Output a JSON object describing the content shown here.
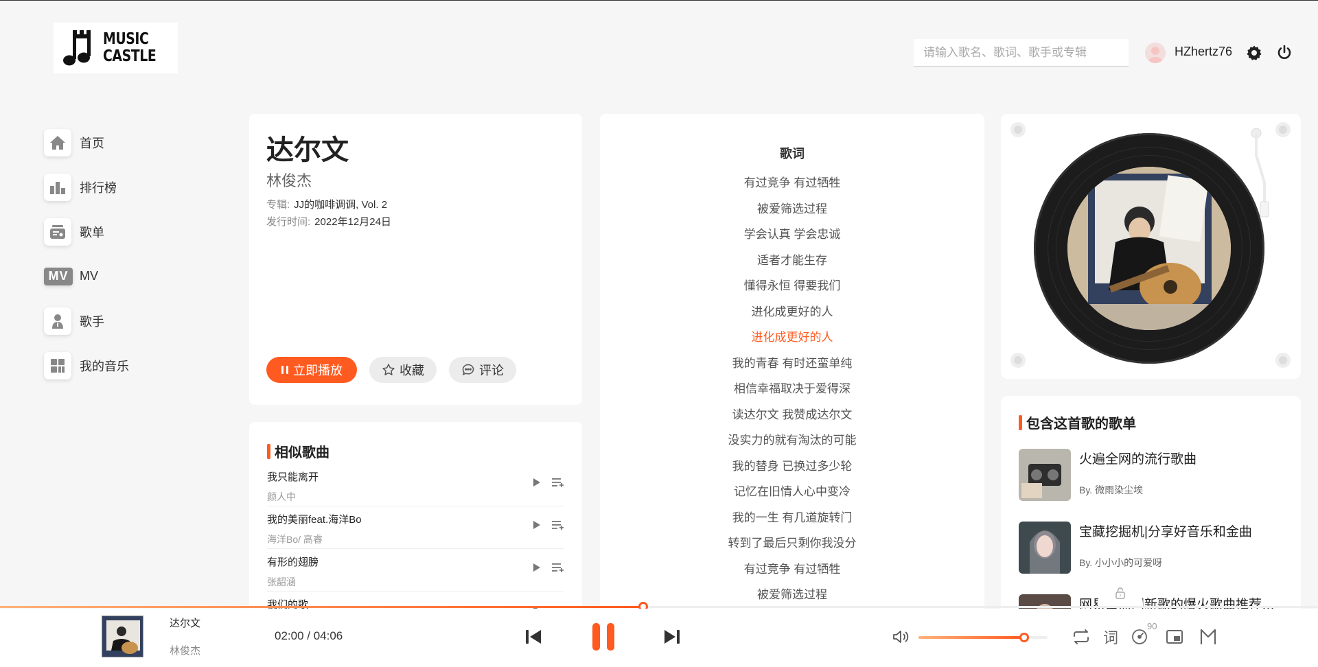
{
  "header": {
    "logo_text_1": "MUSIC",
    "logo_text_2": "CASTLE",
    "search_placeholder": "请输入歌名、歌词、歌手或专辑",
    "username": "HZhertz76"
  },
  "sidebar": {
    "items": [
      {
        "label": "首页",
        "icon": "home-icon"
      },
      {
        "label": "排行榜",
        "icon": "chart-icon"
      },
      {
        "label": "歌单",
        "icon": "playlist-icon"
      },
      {
        "label": "MV",
        "icon": "mv-icon"
      },
      {
        "label": "歌手",
        "icon": "singer-icon"
      },
      {
        "label": "我的音乐",
        "icon": "my-music-icon"
      }
    ],
    "mv_badge": "MV"
  },
  "song": {
    "title": "达尔文",
    "artist": "林俊杰",
    "album_label": "专辑:",
    "album": "JJ的咖啡调调, Vol. 2",
    "release_label": "发行时间:",
    "release": "2022年12月24日",
    "play_label": "立即播放",
    "collect_label": "收藏",
    "comment_label": "评论"
  },
  "similar": {
    "title": "相似歌曲",
    "songs": [
      {
        "name": "我只能离开",
        "artist": "颜人中"
      },
      {
        "name": "我的美丽feat.海洋Bo",
        "artist": "海洋Bo/ 高睿"
      },
      {
        "name": "有形的翅膀",
        "artist": "张韶涵"
      },
      {
        "name": "我们的歌",
        "artist": ""
      }
    ]
  },
  "lyrics": {
    "title": "歌词",
    "active_index": 6,
    "lines": [
      "有过竞争 有过牺牲",
      "被爱筛选过程",
      "学会认真 学会忠诚",
      "适者才能生存",
      "懂得永恒 得要我们",
      "进化成更好的人",
      "进化成更好的人",
      "我的青春 有时还蛮单纯",
      "相信幸福取决于爱得深",
      "读达尔文 我赞成达尔文",
      "没实力的就有淘汰的可能",
      "我的替身 已换过多少轮",
      "记忆在旧情人心中变冷",
      "我的一生 有几道旋转门",
      "转到了最后只剩你我没分",
      "有过竞争 有过牺牲",
      "被爱筛选过程"
    ]
  },
  "playlists": {
    "title": "包含这首歌的歌单",
    "items": [
      {
        "name": "火遍全网的流行歌曲",
        "by": "By. 微雨染尘埃"
      },
      {
        "name": "宝藏挖掘机|分享好音乐和金曲",
        "by": "By. 小小小的可爱呀"
      },
      {
        "name": "网易云热门新歌的爆火歌曲推荐（持续更新）",
        "by": ""
      }
    ]
  },
  "player": {
    "title": "达尔文",
    "artist": "林俊杰",
    "time": "02:00 / 04:06",
    "progress": 0.4878,
    "volume": 0.82,
    "lyric_btn": "词",
    "rate": "90"
  },
  "colors": {
    "accent": "#ff5a1f",
    "background": "#f6f6f6",
    "card": "#ffffff"
  }
}
